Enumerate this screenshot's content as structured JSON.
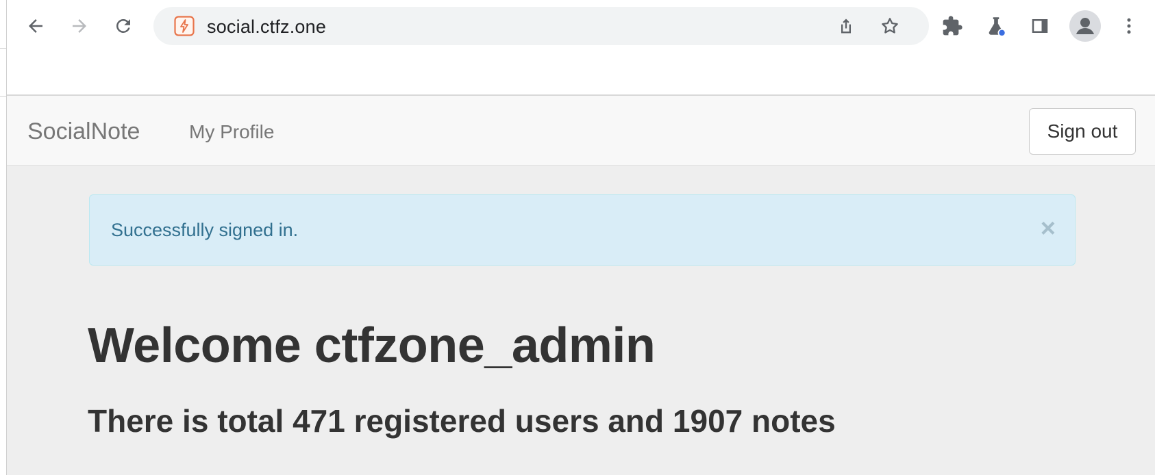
{
  "browser": {
    "url": "social.ctfz.one",
    "icons": {
      "back": "back-arrow-icon",
      "forward": "forward-arrow-icon",
      "reload": "reload-icon",
      "site": "site-info-icon",
      "share": "share-icon",
      "bookmark": "bookmark-star-icon",
      "extensions": "puzzle-icon",
      "labs": "flask-icon",
      "side_panel": "side-panel-icon",
      "profile": "profile-avatar-icon",
      "menu": "more-vert-icon"
    }
  },
  "navbar": {
    "brand": "SocialNote",
    "my_profile": "My Profile",
    "sign_out": "Sign out"
  },
  "alert": {
    "message": "Successfully signed in.",
    "close": "×"
  },
  "main": {
    "welcome": "Welcome ctfzone_admin",
    "stats": "There is total 471 registered users and 1907 notes"
  },
  "colors": {
    "page_bg": "#eeeeee",
    "navbar_bg": "#f8f8f8",
    "alert_bg": "#d9edf7",
    "alert_text": "#31708f",
    "heading": "#333333",
    "nav_text": "#777777"
  }
}
